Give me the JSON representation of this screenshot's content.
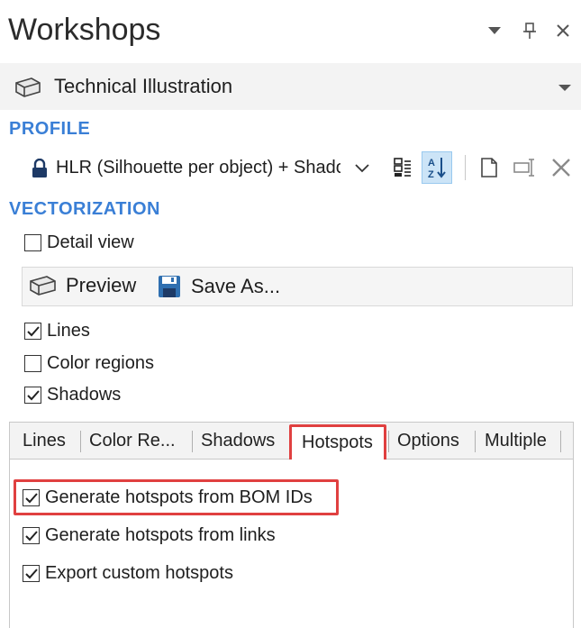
{
  "panel": {
    "title": "Workshops",
    "header_buttons": {
      "dropdown_icon": "chevron-down",
      "pin_icon": "pin",
      "close_icon": "close"
    }
  },
  "workshop": {
    "selected": "Technical Illustration",
    "icon": "workshop-icon"
  },
  "profile": {
    "section_label": "PROFILE",
    "selected": "HLR (Silhouette per object) + Shadows",
    "toolbar_icons": [
      "categorize-icon",
      "sort-az-icon",
      "new-icon",
      "rename-icon",
      "delete-icon"
    ]
  },
  "vectorization": {
    "section_label": "VECTORIZATION",
    "detail_view": {
      "label": "Detail view",
      "checked": false
    },
    "actions": {
      "preview": "Preview",
      "save_as": "Save As..."
    },
    "options": [
      {
        "label": "Lines",
        "checked": true
      },
      {
        "label": "Color regions",
        "checked": false
      },
      {
        "label": "Shadows",
        "checked": true
      }
    ]
  },
  "tabs": {
    "items": [
      "Lines",
      "Color Re...",
      "Shadows",
      "Hotspots",
      "Options",
      "Multiple"
    ],
    "active": "Hotspots"
  },
  "hotspots": {
    "options": [
      {
        "label": "Generate hotspots from BOM IDs",
        "checked": true
      },
      {
        "label": "Generate hotspots from links",
        "checked": true
      },
      {
        "label": "Export custom hotspots",
        "checked": true
      }
    ]
  },
  "colors": {
    "section": "#3a7fd6",
    "highlight": "#e04040",
    "active_tool": "#cce4f7"
  }
}
